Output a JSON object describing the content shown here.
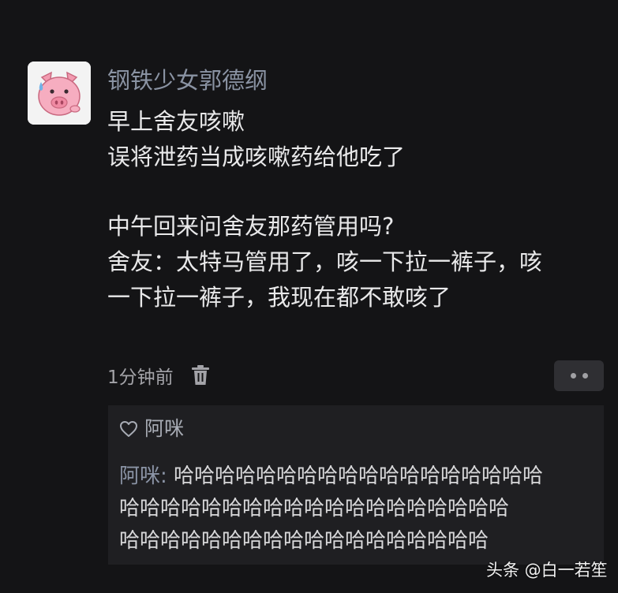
{
  "post": {
    "username": "钢铁少女郭德纲",
    "body_lines": [
      "早上舍友咳嗽",
      "误将泄药当成咳嗽药给他吃了",
      "",
      "中午回来问舍友那药管用吗?",
      "舍友：太特马管用了，咳一下拉一裤子，咳",
      "一下拉一裤子，我现在都不敢咳了"
    ],
    "time": "1分钟前",
    "delete_icon": "trash-icon",
    "more_icon": "more-dots-icon"
  },
  "reply_box": {
    "like_icon": "heart-outline-icon",
    "liker": "阿咪",
    "reply_author": "阿咪:",
    "reply_lines": [
      " 哈哈哈哈哈哈哈哈哈哈哈哈哈哈哈哈哈哈",
      "哈哈哈哈哈哈哈哈哈哈哈哈哈哈哈哈哈哈哈",
      "哈哈哈哈哈哈哈哈哈哈哈哈哈哈哈哈哈哈"
    ]
  },
  "watermark": "头条 @白一若笙",
  "colors": {
    "background": "#141416",
    "username": "#8a93a3",
    "body_text": "#e9e9ea",
    "reply_box": "#1f1f22",
    "avatar_pig": "#f3a6b8"
  }
}
